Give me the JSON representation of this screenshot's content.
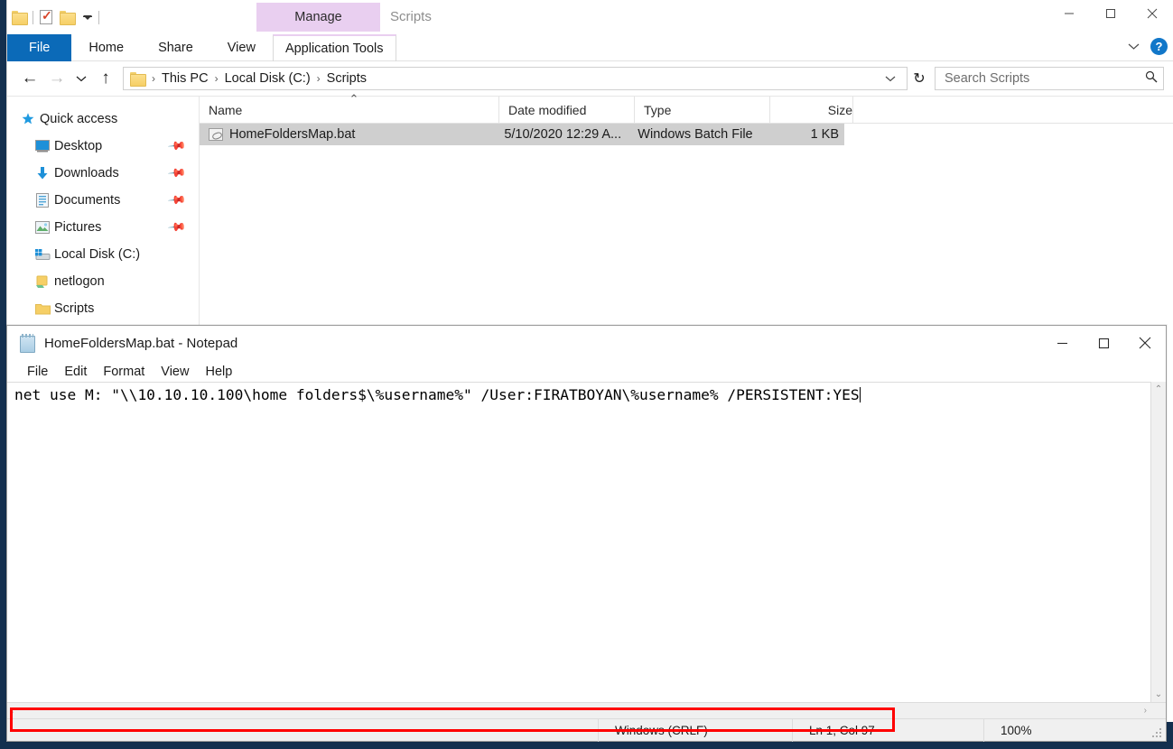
{
  "explorer": {
    "window_title": "Scripts",
    "quick_access_toolbar": [
      {
        "icon": "folder-icon",
        "name": "properties-folder-icon"
      },
      {
        "icon": "checkbox-icon",
        "name": "new-folder-icon"
      },
      {
        "icon": "folder-icon",
        "name": "folder-icon"
      },
      {
        "icon": "chevron-down-icon",
        "name": "customize-qat-icon"
      }
    ],
    "contextual_tab_group": "Manage",
    "ribbon_tabs": [
      {
        "label": "File",
        "active": true
      },
      {
        "label": "Home",
        "active": false
      },
      {
        "label": "Share",
        "active": false
      },
      {
        "label": "View",
        "active": false
      },
      {
        "label": "Application Tools",
        "active": false
      }
    ],
    "window_controls": {
      "minimize": "Minimize",
      "maximize": "Maximize",
      "close": "Close"
    },
    "ribbon_right": {
      "collapse": "Collapse the Ribbon",
      "help": "?"
    },
    "address": {
      "breadcrumbs": [
        "This PC",
        "Local Disk (C:)",
        "Scripts"
      ],
      "separator": "›"
    },
    "refresh_label": "Refresh",
    "search": {
      "placeholder": "Search Scripts",
      "value": ""
    },
    "nav_pane": [
      {
        "label": "Quick access",
        "icon": "star-icon",
        "indent": false,
        "pinned": false
      },
      {
        "label": "Desktop",
        "icon": "desktop-icon",
        "indent": true,
        "pinned": true
      },
      {
        "label": "Downloads",
        "icon": "download-icon",
        "indent": true,
        "pinned": true
      },
      {
        "label": "Documents",
        "icon": "documents-icon",
        "indent": true,
        "pinned": true
      },
      {
        "label": "Pictures",
        "icon": "pictures-icon",
        "indent": true,
        "pinned": true
      },
      {
        "label": "Local Disk (C:)",
        "icon": "drive-icon",
        "indent": true,
        "pinned": false
      },
      {
        "label": "netlogon",
        "icon": "network-folder-icon",
        "indent": true,
        "pinned": false
      },
      {
        "label": "Scripts",
        "icon": "folder-icon",
        "indent": true,
        "pinned": false
      }
    ],
    "columns": [
      {
        "key": "name",
        "label": "Name",
        "sorted": true
      },
      {
        "key": "date",
        "label": "Date modified",
        "sorted": false
      },
      {
        "key": "type",
        "label": "Type",
        "sorted": false
      },
      {
        "key": "size",
        "label": "Size",
        "sorted": false
      }
    ],
    "files": [
      {
        "name": "HomeFoldersMap.bat",
        "date": "5/10/2020 12:29 A...",
        "type": "Windows Batch File",
        "size": "1 KB",
        "icon": "batch-file-icon",
        "selected": true
      }
    ]
  },
  "notepad": {
    "title": "HomeFoldersMap.bat - Notepad",
    "icon": "notepad-icon",
    "menu": [
      "File",
      "Edit",
      "Format",
      "View",
      "Help"
    ],
    "window_controls": {
      "minimize": "Minimize",
      "maximize": "Maximize",
      "close": "Close"
    },
    "content": "net use M: \"\\\\10.10.10.100\\home folders$\\%username%\" /User:FIRATBOYAN\\%username% /PERSISTENT:YES",
    "highlight_color": "#ff0000",
    "status": {
      "line_ending": "Windows (CRLF)",
      "cursor": "Ln 1, Col 97",
      "zoom": "100%"
    },
    "scroll": {
      "v_up": "⌃",
      "v_down": "⌄",
      "h_left": "‹",
      "h_right": "›"
    }
  }
}
